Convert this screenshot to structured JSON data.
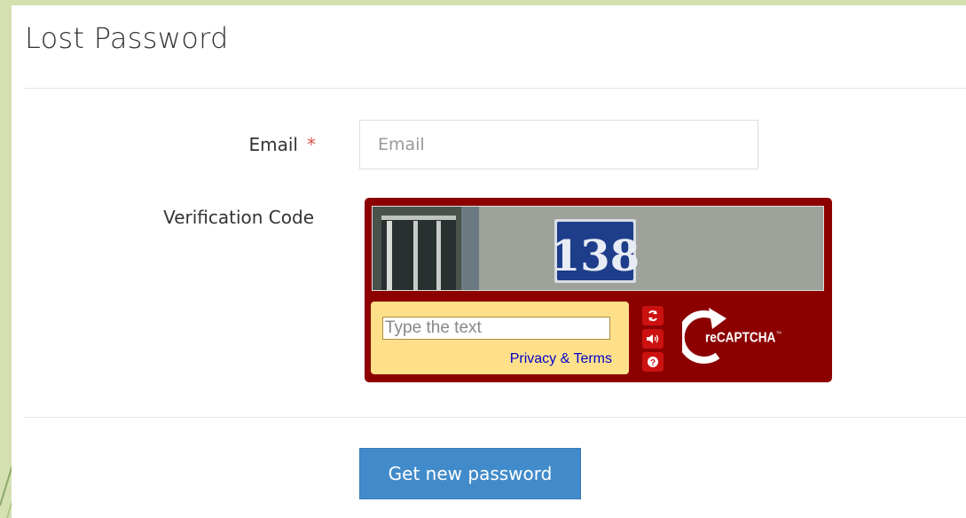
{
  "page": {
    "title": "Lost Password"
  },
  "form": {
    "email_label": "Email",
    "required_marker": "*",
    "email_placeholder": "Email",
    "email_value": "",
    "verification_label": "Verification Code"
  },
  "captcha": {
    "image_number": "138",
    "input_placeholder": "Type the text",
    "privacy_terms_link": "Privacy & Terms",
    "buttons": {
      "reload": "refresh-icon",
      "audio": "audio-icon",
      "help": "help-icon"
    },
    "logo_text": "reCAPTCHA",
    "logo_tm": "™"
  },
  "actions": {
    "submit_label": "Get new password"
  },
  "colors": {
    "accent": "#428bca",
    "captcha_frame": "#8c0000",
    "captcha_input_bg": "#ffe08a",
    "required": "#d9534f"
  }
}
